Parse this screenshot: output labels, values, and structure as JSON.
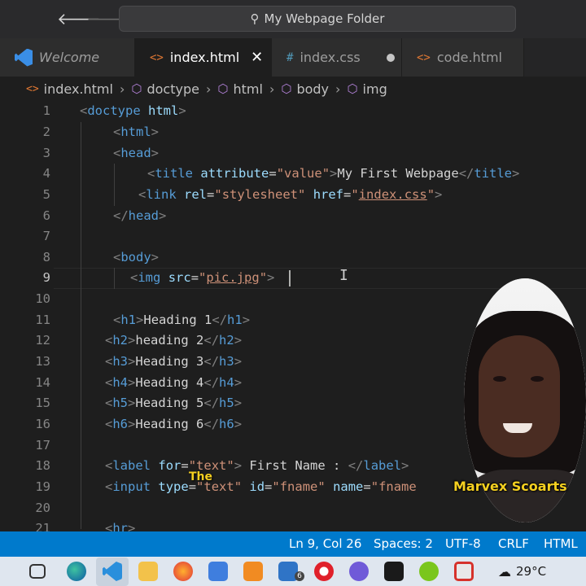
{
  "titlebar": {
    "search_text": "My Webpage Folder"
  },
  "tabs": [
    {
      "label": "Welcome",
      "icon": "vscode-logo-icon"
    },
    {
      "label": "index.html",
      "icon": "html-icon"
    },
    {
      "label": "index.css",
      "icon": "css-icon"
    },
    {
      "label": "code.html",
      "icon": "html-icon"
    }
  ],
  "breadcrumb": [
    "index.html",
    "doctype",
    "html",
    "body",
    "img"
  ],
  "editor": {
    "line_numbers": [
      "1",
      "2",
      "3",
      "4",
      "5",
      "6",
      "7",
      "8",
      "9",
      "10",
      "11",
      "12",
      "13",
      "14",
      "15",
      "16",
      "17",
      "18",
      "19",
      "20",
      "21"
    ],
    "code": {
      "l1": {
        "open": "<",
        "tag": "doctype",
        "attr": "html",
        "close": ">"
      },
      "l2": {
        "open": "<",
        "tag": "html",
        "close": ">"
      },
      "l3": {
        "open": "<",
        "tag": "head",
        "close": ">"
      },
      "l4": {
        "open": "<",
        "tag": "title",
        "attr": "attribute",
        "eq": "=",
        "val": "\"value\"",
        "gt": ">",
        "text": "My First Webpage",
        "end_open": "</",
        "end_tag": "title",
        "end_close": ">"
      },
      "l5": {
        "open": "<",
        "tag": "link",
        "a1": "rel",
        "eq1": "=",
        "v1": "\"stylesheet\"",
        "a2": "href",
        "eq2": "=",
        "q1": "\"",
        "v2": "index.css",
        "q2": "\"",
        "close": ">"
      },
      "l6": {
        "open": "</",
        "tag": "head",
        "close": ">"
      },
      "l8": {
        "open": "<",
        "tag": "body",
        "close": ">"
      },
      "l9": {
        "open": "<",
        "tag": "img",
        "attr": "src",
        "eq": "=",
        "q1": "\"",
        "val": "pic.jpg",
        "q2": "\"",
        "close": ">"
      },
      "l11": {
        "open": "<",
        "tag": "h1",
        "gt": ">",
        "text": "Heading 1",
        "end_open": "</",
        "end_tag": "h1",
        "end_close": ">"
      },
      "l12": {
        "open": "<",
        "tag": "h2",
        "gt": ">",
        "text": "heading 2",
        "end_open": "</",
        "end_tag": "h2",
        "end_close": ">"
      },
      "l13": {
        "open": "<",
        "tag": "h3",
        "gt": ">",
        "text": "Heading 3",
        "end_open": "</",
        "end_tag": "h3",
        "end_close": ">"
      },
      "l14": {
        "open": "<",
        "tag": "h4",
        "gt": ">",
        "text": "Heading 4",
        "end_open": "</",
        "end_tag": "h4",
        "end_close": ">"
      },
      "l15": {
        "open": "<",
        "tag": "h5",
        "gt": ">",
        "text": "Heading 5",
        "end_open": "</",
        "end_tag": "h5",
        "end_close": ">"
      },
      "l16": {
        "open": "<",
        "tag": "h6",
        "gt": ">",
        "text": "Heading 6",
        "end_open": "</",
        "end_tag": "h6",
        "end_close": ">"
      },
      "l18": {
        "open": "<",
        "tag": "label",
        "attr": "for",
        "eq": "=",
        "val": "\"text\"",
        "gt": ">",
        "text": " First Name : ",
        "end_open": "</",
        "end_tag": "label",
        "end_close": ">"
      },
      "l19": {
        "open": "<",
        "tag": "input",
        "a1": "type",
        "eq1": "=",
        "v1": "\"text\"",
        "a2": "id",
        "eq2": "=",
        "v2": "\"fname\"",
        "a3": "name",
        "eq3": "=",
        "v3": "\"fname"
      },
      "l21": {
        "open": "<",
        "tag": "hr",
        "close": ">"
      }
    }
  },
  "overlay": {
    "presenter_name": "Marvex Scoarts",
    "caption_word": "The"
  },
  "statusbar": {
    "position": "Ln 9, Col 26",
    "spaces": "Spaces: 2",
    "encoding": "UTF-8",
    "eol": "CRLF",
    "language": "HTML"
  },
  "taskbar": {
    "temperature": "29°C",
    "badge_count": "6",
    "icons": [
      "task-view-icon",
      "edge-icon",
      "vscode-icon",
      "file-explorer-icon",
      "firefox-icon",
      "store-icon",
      "sublime-icon",
      "mail-icon",
      "opera-icon",
      "media-icon",
      "terminal-icon",
      "app-green-icon",
      "app-red-icon"
    ]
  },
  "colors": {
    "accent": "#007acc",
    "tag": "#569cd6",
    "attribute": "#9cdcfe",
    "string": "#ce9178",
    "caption": "#f5d020"
  }
}
